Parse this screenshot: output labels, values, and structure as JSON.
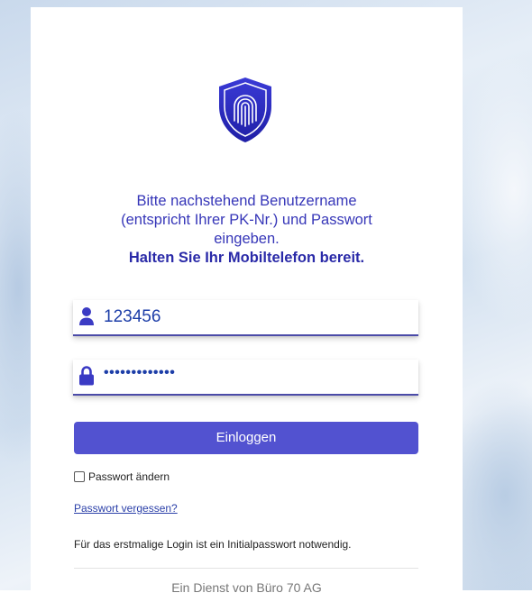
{
  "intro": {
    "line1": "Bitte nachstehend Benutzername",
    "line2": "(entspricht Ihrer PK-Nr.) und Passwort",
    "line3": "eingeben.",
    "bold": "Halten Sie Ihr Mobiltelefon bereit."
  },
  "username": {
    "icon": "user-icon",
    "value": "123456"
  },
  "password": {
    "icon": "lock-icon",
    "value": "•••••••••••••"
  },
  "login_button": {
    "label": "Einloggen"
  },
  "change_password": {
    "label": "Passwort ändern",
    "checked": false
  },
  "forgot_password": {
    "label": "Passwort vergessen?"
  },
  "note": "Für das erstmalige Login ist ein Initialpasswort notwendig.",
  "footer": "Ein Dienst von Büro 70 AG",
  "colors": {
    "accent": "#5252d0",
    "text_primary": "#3636b8",
    "link": "#2a3fa8"
  }
}
